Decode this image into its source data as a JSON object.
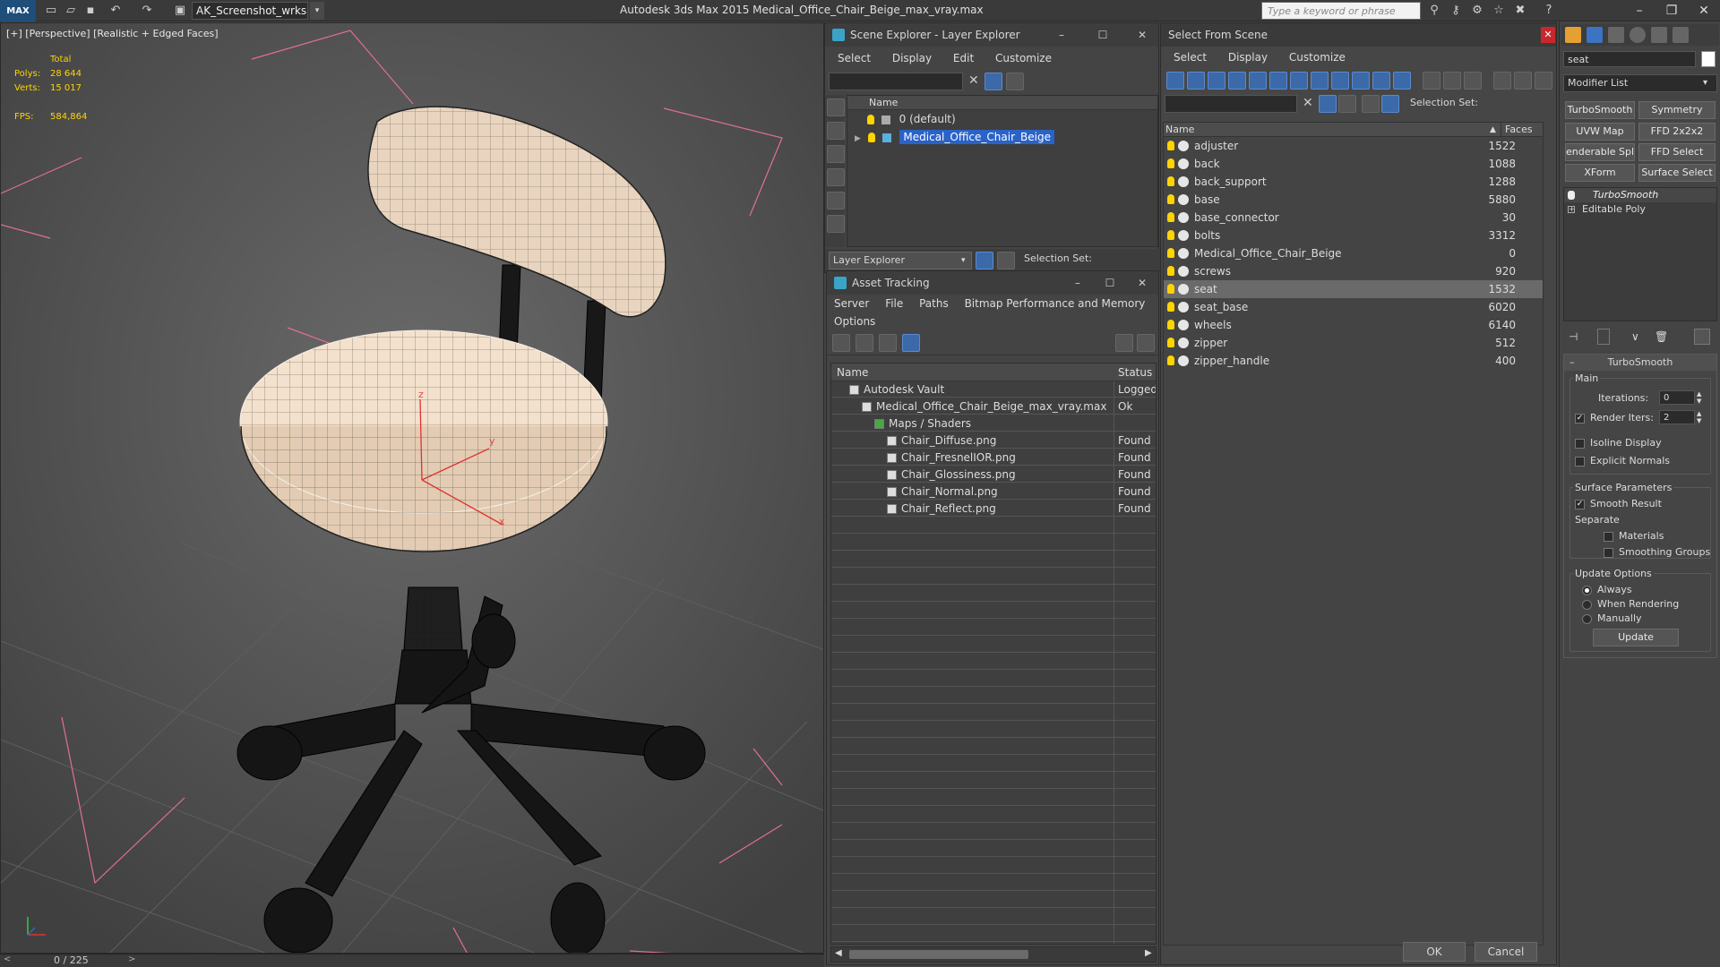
{
  "app": {
    "logo": "MAX",
    "workspace": "AK_Screenshot_wrksp",
    "title": "Autodesk 3ds Max  2015     Medical_Office_Chair_Beige_max_vray.max",
    "search_placeholder": "Type a keyword or phrase"
  },
  "viewport": {
    "label": "[+] [Perspective] [Realistic + Edged Faces]",
    "stats": {
      "total_label": "Total",
      "polys_label": "Polys:",
      "polys_value": "28 644",
      "verts_label": "Verts:",
      "verts_value": "15 017",
      "fps_label": "FPS:",
      "fps_value": "584,864"
    },
    "axis_x": "x",
    "axis_y": "y",
    "axis_z": "z",
    "timeline_value": "0 / 225"
  },
  "scene_explorer": {
    "title": "Scene Explorer - Layer Explorer",
    "menu": [
      "Select",
      "Display",
      "Edit",
      "Customize"
    ],
    "col_name": "Name",
    "layers": [
      {
        "name": "0 (default)",
        "selected": false
      },
      {
        "name": "Medical_Office_Chair_Beige",
        "selected": true
      }
    ],
    "explorer_select": "Layer Explorer",
    "selection_set_label": "Selection Set:"
  },
  "asset_tracking": {
    "title": "Asset Tracking",
    "menu": [
      "Server",
      "File",
      "Paths",
      "Bitmap Performance and Memory"
    ],
    "menu2": "Options",
    "col_name": "Name",
    "col_status": "Status",
    "rows": [
      {
        "name": "Autodesk Vault",
        "status": "Logged",
        "indent": 1
      },
      {
        "name": "Medical_Office_Chair_Beige_max_vray.max",
        "status": "Ok",
        "indent": 2
      },
      {
        "name": "Maps / Shaders",
        "status": "",
        "indent": 3
      },
      {
        "name": "Chair_Diffuse.png",
        "status": "Found",
        "indent": 4
      },
      {
        "name": "Chair_FresnelIOR.png",
        "status": "Found",
        "indent": 4
      },
      {
        "name": "Chair_Glossiness.png",
        "status": "Found",
        "indent": 4
      },
      {
        "name": "Chair_Normal.png",
        "status": "Found",
        "indent": 4
      },
      {
        "name": "Chair_Reflect.png",
        "status": "Found",
        "indent": 4
      }
    ]
  },
  "select_from_scene": {
    "title": "Select From Scene",
    "menu": [
      "Select",
      "Display",
      "Customize"
    ],
    "selection_set_label": "Selection Set:",
    "col_name": "Name",
    "col_faces": "Faces",
    "objects": [
      {
        "name": "adjuster",
        "faces": "1522",
        "selected": false
      },
      {
        "name": "back",
        "faces": "1088",
        "selected": false
      },
      {
        "name": "back_support",
        "faces": "1288",
        "selected": false
      },
      {
        "name": "base",
        "faces": "5880",
        "selected": false
      },
      {
        "name": "base_connector",
        "faces": "30",
        "selected": false
      },
      {
        "name": "bolts",
        "faces": "3312",
        "selected": false
      },
      {
        "name": "Medical_Office_Chair_Beige",
        "faces": "0",
        "selected": false
      },
      {
        "name": "screws",
        "faces": "920",
        "selected": false
      },
      {
        "name": "seat",
        "faces": "1532",
        "selected": true
      },
      {
        "name": "seat_base",
        "faces": "6020",
        "selected": false
      },
      {
        "name": "wheels",
        "faces": "6140",
        "selected": false
      },
      {
        "name": "zipper",
        "faces": "512",
        "selected": false
      },
      {
        "name": "zipper_handle",
        "faces": "400",
        "selected": false
      }
    ],
    "ok_label": "OK",
    "cancel_label": "Cancel"
  },
  "modifier_panel": {
    "object_name": "seat",
    "modifier_list": "Modifier List",
    "buttons": [
      "TurboSmooth",
      "Symmetry",
      "UVW Map",
      "FFD 2x2x2",
      "enderable Splir",
      "FFD Select",
      "XForm",
      "Surface Select"
    ],
    "stack": [
      "TurboSmooth",
      "Editable Poly"
    ],
    "rollout_title": "TurboSmooth",
    "main_label": "Main",
    "iterations_label": "Iterations:",
    "iterations_value": "0",
    "render_iters_label": "Render Iters:",
    "render_iters_value": "2",
    "isoline_label": "Isoline Display",
    "explicit_normals_label": "Explicit Normals",
    "surface_params_label": "Surface Parameters",
    "smooth_result_label": "Smooth Result",
    "separate_label": "Separate",
    "materials_label": "Materials",
    "smoothing_groups_label": "Smoothing Groups",
    "update_options_label": "Update Options",
    "always_label": "Always",
    "when_rendering_label": "When Rendering",
    "manually_label": "Manually",
    "update_label": "Update"
  }
}
